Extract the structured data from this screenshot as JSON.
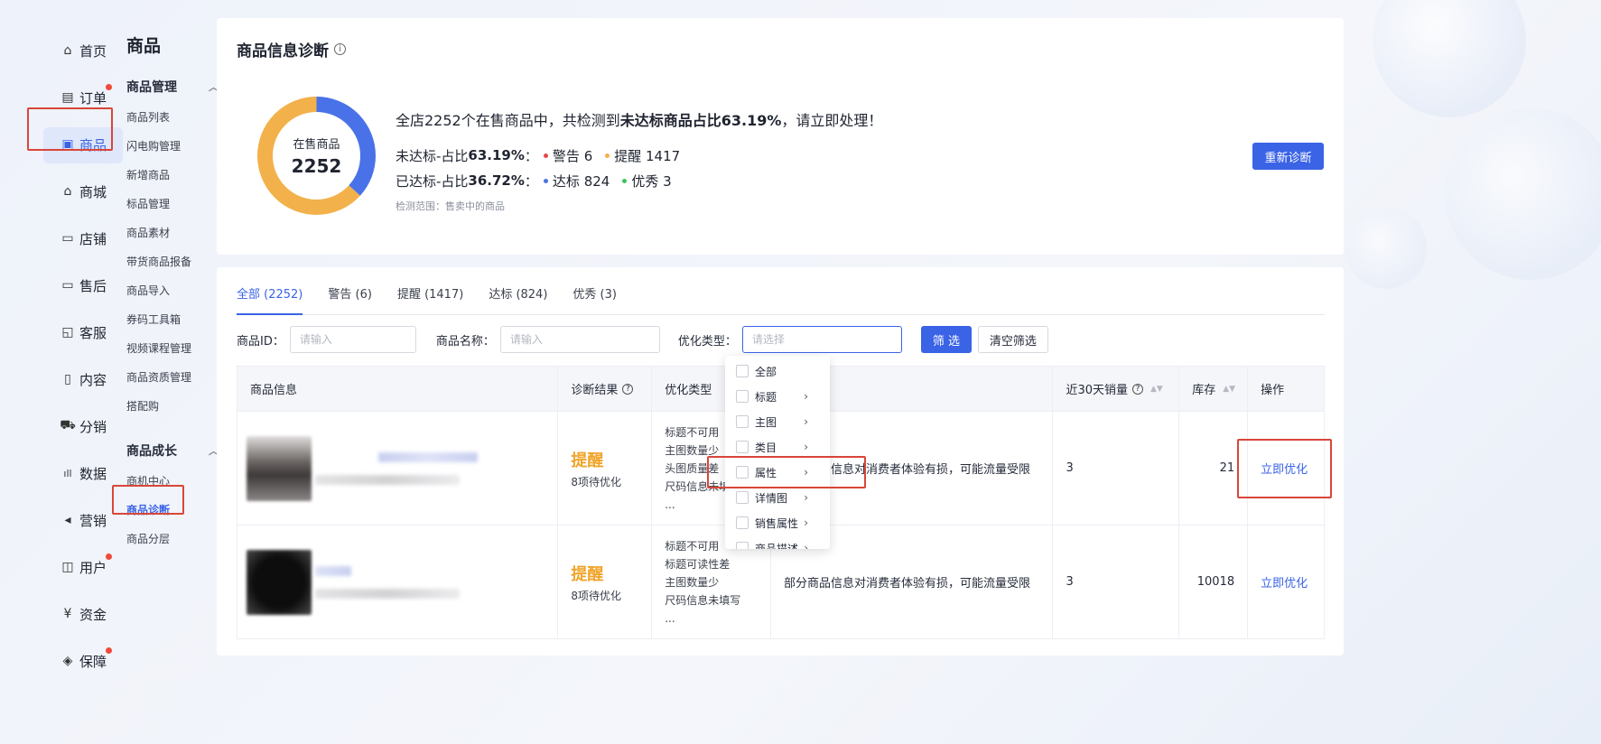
{
  "left_nav": {
    "items": [
      {
        "label": "首页",
        "icon": "⌂"
      },
      {
        "label": "订单",
        "icon": "▤"
      },
      {
        "label": "商品",
        "icon": "▣"
      },
      {
        "label": "商城",
        "icon": "⌂"
      },
      {
        "label": "店铺",
        "icon": "▭"
      },
      {
        "label": "售后",
        "icon": "▭"
      },
      {
        "label": "客服",
        "icon": "◱"
      },
      {
        "label": "内容",
        "icon": "▯"
      },
      {
        "label": "分销",
        "icon": "⛟"
      },
      {
        "label": "数据",
        "icon": "ıll"
      },
      {
        "label": "营销",
        "icon": "◂"
      },
      {
        "label": "用户",
        "icon": "◫"
      },
      {
        "label": "资金",
        "icon": "¥"
      },
      {
        "label": "保障",
        "icon": "◈"
      }
    ]
  },
  "sub_nav": {
    "title": "商品",
    "group1": "商品管理",
    "group1_items": [
      "商品列表",
      "闪电购管理",
      "新增商品",
      "标品管理",
      "商品素材",
      "带货商品报备",
      "商品导入",
      "券码工具箱",
      "视频课程管理",
      "商品资质管理",
      "搭配购"
    ],
    "group2": "商品成长",
    "group2_items": [
      "商机中心",
      "商品诊断",
      "商品分层"
    ]
  },
  "diagnosis": {
    "title": "商品信息诊断",
    "info_icon": "i",
    "donut_label": "在售商品",
    "donut_value": "2252",
    "headline_pre": "全店2252个在售商品中，共检测到",
    "headline_bold": "未达标商品占比63.19%",
    "headline_post": "，请立即处理！",
    "line1_pre": "未达标-占比",
    "line1_pct": "63.19%",
    "line1_colon": "：",
    "warn_label": "警告 6",
    "remind_label": "提醒 1417",
    "line2_pre": "已达标-占比",
    "line2_pct": "36.72%",
    "line2_colon": "：",
    "std_label": "达标 824",
    "excellent_label": "优秀 3",
    "scope": "检测范围：售卖中的商品",
    "rediagnose_button": "重新诊断",
    "chart_data": {
      "type": "pie",
      "categories": [
        "未达标",
        "已达标"
      ],
      "values": [
        63.19,
        36.72
      ],
      "colors": [
        "#f2b14a",
        "#4a72e8"
      ]
    },
    "colors": {
      "warn": "#e5484d",
      "remind": "#f2b14a",
      "std": "#4a72e8",
      "excellent": "#3ec25d"
    }
  },
  "tabs": [
    "全部 (2252)",
    "警告 (6)",
    "提醒 (1417)",
    "达标 (824)",
    "优秀 (3)"
  ],
  "filters": {
    "id_label": "商品ID：",
    "id_placeholder": "请输入",
    "name_label": "商品名称：",
    "name_placeholder": "请输入",
    "type_label": "优化类型：",
    "type_placeholder": "请选择",
    "filter_button": "筛 选",
    "clear_button": "清空筛选"
  },
  "table": {
    "headers": [
      "商品信息",
      "诊断结果",
      "优化类型",
      "",
      "近30天销量",
      "库存",
      "操作"
    ],
    "help_icon": "?",
    "sort_icon": "▲▼",
    "rows": [
      {
        "result": "提醒",
        "pending": "8项待优化",
        "types": [
          "标题不可用",
          "主图数量少",
          "头图质量差",
          "尺码信息未填",
          "..."
        ],
        "impact": "部分商品信息对消费者体验有损，可能流量受限",
        "sales": "3",
        "stock": "21",
        "action": "立即优化"
      },
      {
        "result": "提醒",
        "pending": "8项待优化",
        "types": [
          "标题不可用",
          "标题可读性差",
          "主图数量少",
          "尺码信息未填写",
          "..."
        ],
        "impact": "部分商品信息对消费者体验有损，可能流量受限",
        "sales": "3",
        "stock": "10018",
        "action": "立即优化"
      }
    ]
  },
  "dropdown": {
    "options": [
      "全部",
      "标题",
      "主图",
      "类目",
      "属性",
      "详情图",
      "销售属性",
      "商品描述"
    ],
    "arrow": "›"
  }
}
